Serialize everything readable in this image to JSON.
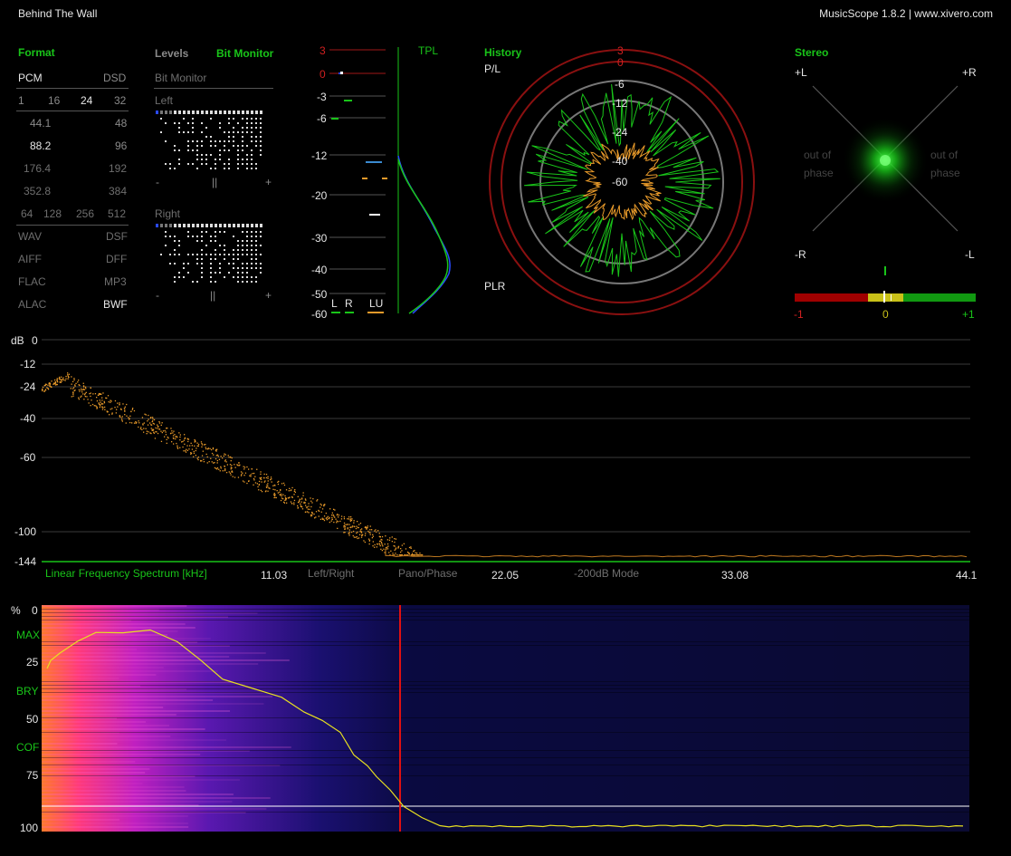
{
  "window": {
    "track_title": "Behind The Wall",
    "app_title": "MusicScope 1.8.2 | www.xivero.com"
  },
  "format": {
    "title": "Format",
    "pcm": "PCM",
    "dsd": "DSD",
    "bits": [
      "1",
      "16",
      "24",
      "32"
    ],
    "rates_pcm": [
      "44.1",
      "88.2",
      "176.4",
      "352.8"
    ],
    "rates_dsd": [
      "48",
      "96",
      "192",
      "384"
    ],
    "dsd_rates": [
      "64",
      "128",
      "256",
      "512"
    ],
    "containers_left": [
      "WAV",
      "AIFF",
      "FLAC",
      "ALAC"
    ],
    "containers_right": [
      "DSF",
      "DFF",
      "MP3",
      "BWF"
    ]
  },
  "levels_tabs": {
    "levels": "Levels",
    "bit_monitor": "Bit Monitor"
  },
  "bit_monitor": {
    "title": "Bit Monitor",
    "left": "Left",
    "right": "Right",
    "minus": "-",
    "mid": "||",
    "plus": "+"
  },
  "meters": {
    "scale": [
      "3",
      "0",
      "-3",
      "-6",
      "-12",
      "-20",
      "-30",
      "-40",
      "-50",
      "-60"
    ],
    "tpl": "TPL",
    "l": "L",
    "r": "R",
    "lu": "LU"
  },
  "history": {
    "title": "History",
    "pl": "P/L",
    "plr": "PLR",
    "rings": [
      "3",
      "0",
      "-6",
      "-12",
      "-24",
      "-40",
      "-60"
    ]
  },
  "stereo": {
    "title": "Stereo",
    "plus_l": "+L",
    "plus_r": "+R",
    "minus_r": "-R",
    "minus_l": "-L",
    "out": "out of",
    "phase": "phase",
    "corr_min": "-1",
    "corr_mid": "0",
    "corr_max": "+1"
  },
  "spectrum": {
    "db": "dB",
    "y_ticks": [
      "0",
      "-12",
      "-24",
      "-40",
      "-60",
      "-100",
      "-144"
    ],
    "title": "Linear Frequency Spectrum [kHz]",
    "modes": [
      "Left/Right",
      "Pano/Phase",
      "-200dB Mode"
    ],
    "x_ticks": [
      "11.03",
      "22.05",
      "33.08",
      "44.1"
    ]
  },
  "spectrogram": {
    "pct": "%",
    "y_ticks": [
      "0",
      "25",
      "50",
      "75",
      "100"
    ],
    "markers": [
      "MAX",
      "BRY",
      "COF"
    ]
  },
  "colors": {
    "accent_green": "#19c419",
    "red": "#d02020",
    "orange": "#e89a2a",
    "yellow": "#e8e020"
  }
}
